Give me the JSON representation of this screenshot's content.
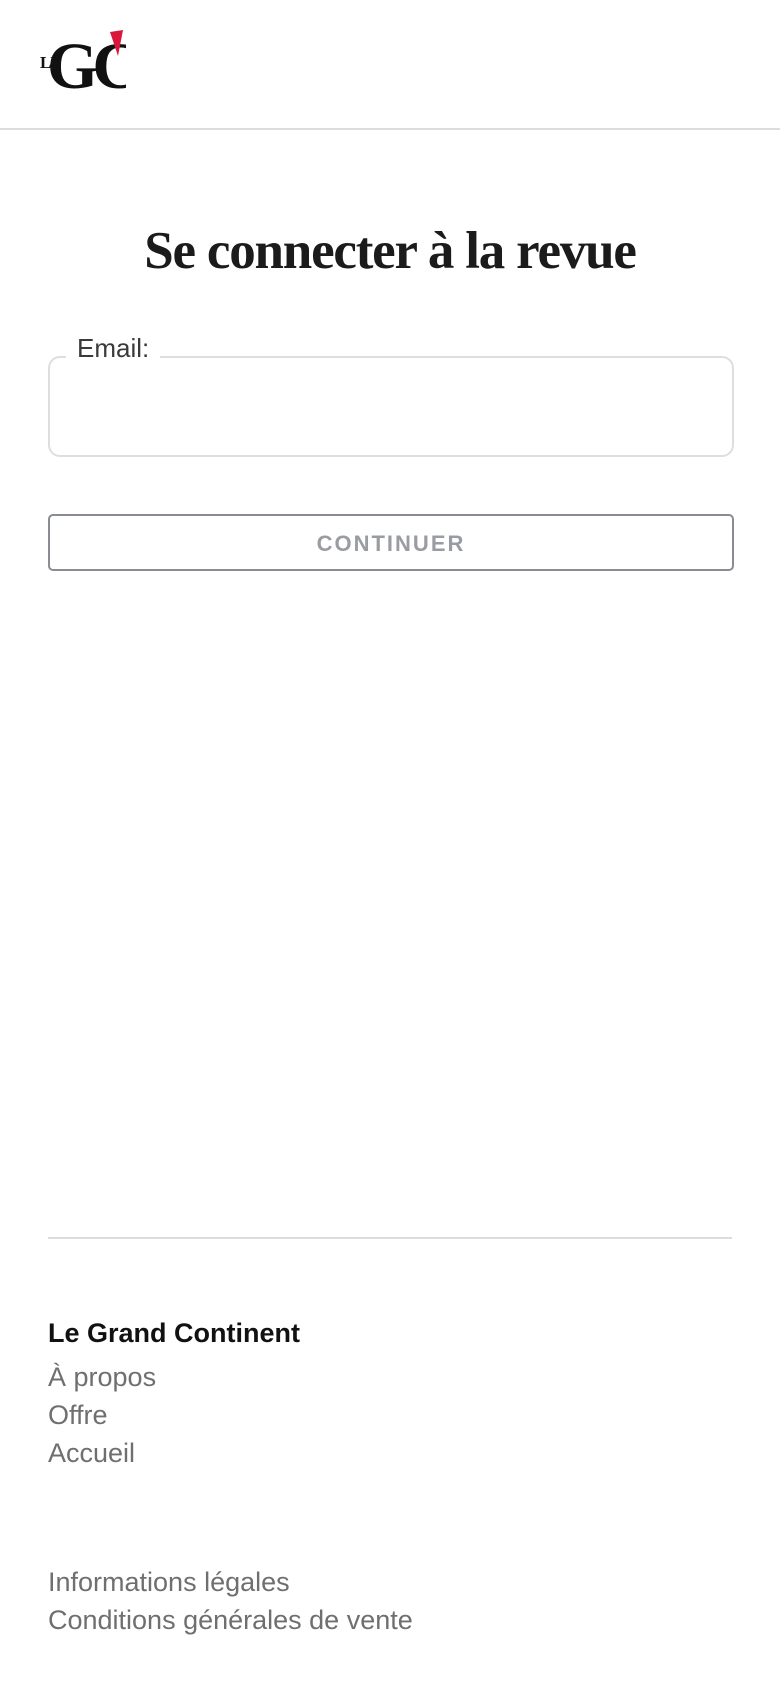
{
  "header": {
    "logo": {
      "name": "Le Grand Continent logo",
      "text_small": "LE",
      "text_large": "GC",
      "accent_color": "#d8173a"
    }
  },
  "main": {
    "title": "Se connecter à la revue",
    "email": {
      "label": "Email:",
      "value": "",
      "placeholder": ""
    },
    "continue_label": "CONTINUER"
  },
  "footer": {
    "brand": "Le Grand Continent",
    "links": [
      {
        "label": "À propos"
      },
      {
        "label": "Offre"
      },
      {
        "label": "Accueil"
      }
    ],
    "legal_links": [
      {
        "label": "Informations légales"
      },
      {
        "label": "Conditions générales de vente"
      }
    ]
  },
  "colors": {
    "accent": "#d8173a",
    "text": "#1b1b1b",
    "muted_link": "#6f6f6f",
    "button_text_disabled": "#9a9ca3"
  }
}
